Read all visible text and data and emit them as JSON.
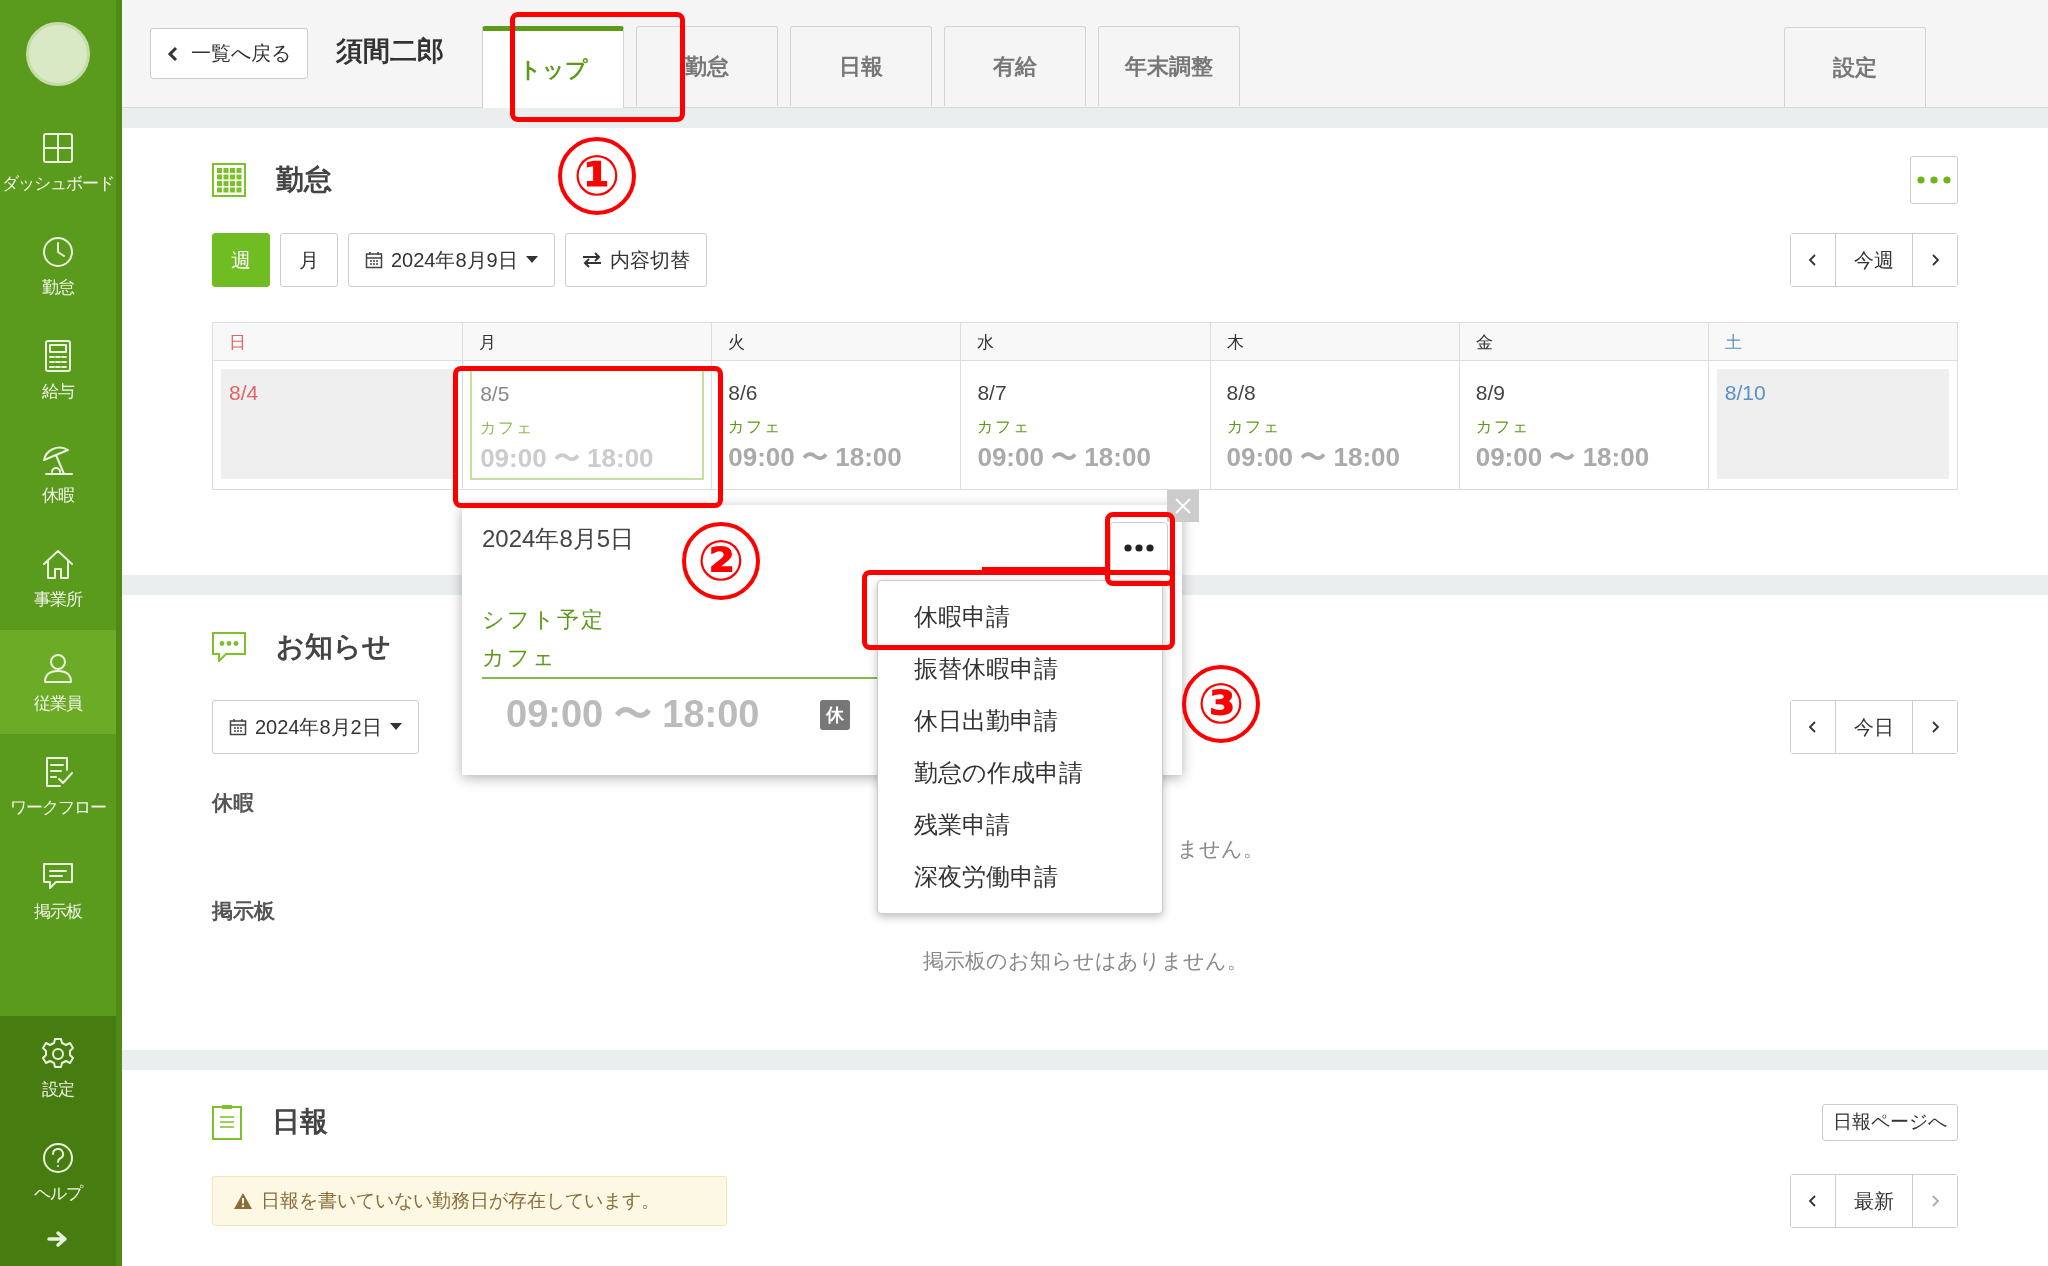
{
  "sidebar": {
    "items": [
      {
        "label": "ダッシュボード",
        "selected": false
      },
      {
        "label": "勤怠",
        "selected": false
      },
      {
        "label": "給与",
        "selected": false
      },
      {
        "label": "休暇",
        "selected": false
      },
      {
        "label": "事業所",
        "selected": false
      },
      {
        "label": "従業員",
        "selected": true
      },
      {
        "label": "ワークフロー",
        "selected": false
      },
      {
        "label": "掲示板",
        "selected": false
      }
    ],
    "bottom_items": [
      {
        "label": "設定"
      },
      {
        "label": "ヘルプ"
      }
    ]
  },
  "header": {
    "back_button": "一覧へ戻る",
    "employee_name": "須間二郎",
    "tabs": [
      {
        "label": "トップ",
        "selected": true
      },
      {
        "label": "勤怠",
        "selected": false
      },
      {
        "label": "日報",
        "selected": false
      },
      {
        "label": "有給",
        "selected": false
      },
      {
        "label": "年末調整",
        "selected": false
      }
    ],
    "settings_tab": "設定"
  },
  "attendance": {
    "title": "勤怠",
    "view_buttons": [
      {
        "label": "週",
        "selected": true
      },
      {
        "label": "月",
        "selected": false
      }
    ],
    "date_picker": "2024年8月9日",
    "toggle_button": "内容切替",
    "nav_label": "今週",
    "days": [
      {
        "weekday": "日",
        "date": "8/4",
        "kind": "sunday",
        "selected": false
      },
      {
        "weekday": "月",
        "date": "8/5",
        "kind": "weekday",
        "shift": "カフェ",
        "time": "09:00 〜 18:00",
        "selected": true
      },
      {
        "weekday": "火",
        "date": "8/6",
        "kind": "weekday",
        "shift": "カフェ",
        "time": "09:00 〜 18:00",
        "selected": false
      },
      {
        "weekday": "水",
        "date": "8/7",
        "kind": "weekday",
        "shift": "カフェ",
        "time": "09:00 〜 18:00",
        "selected": false
      },
      {
        "weekday": "木",
        "date": "8/8",
        "kind": "weekday",
        "shift": "カフェ",
        "time": "09:00 〜 18:00",
        "selected": false
      },
      {
        "weekday": "金",
        "date": "8/9",
        "kind": "weekday",
        "shift": "カフェ",
        "time": "09:00 〜 18:00",
        "selected": false
      },
      {
        "weekday": "土",
        "date": "8/10",
        "kind": "saturday",
        "selected": false
      }
    ]
  },
  "popup": {
    "date": "2024年8月5日",
    "label": "シフト予定",
    "shift": "カフェ",
    "time": "09:00 〜 18:00",
    "badge": "休"
  },
  "menu": {
    "items": [
      {
        "label": "休暇申請"
      },
      {
        "label": "振替休暇申請"
      },
      {
        "label": "休日出勤申請"
      },
      {
        "label": "勤怠の作成申請"
      },
      {
        "label": "残業申請"
      },
      {
        "label": "深夜労働申請"
      }
    ]
  },
  "notices": {
    "title": "お知らせ",
    "date_picker": "2024年8月2日",
    "nav_label": "今日",
    "groups": [
      {
        "label": "休暇",
        "message": "ません。"
      },
      {
        "label": "掲示板",
        "message": "掲示板のお知らせはありません。"
      }
    ]
  },
  "daily_report": {
    "title": "日報",
    "page_button": "日報ページへ",
    "warning": "日報を書いていない勤務日が存在しています。",
    "nav_label": "最新"
  },
  "annotations": [
    {
      "label": "①"
    },
    {
      "label": "②"
    },
    {
      "label": "③"
    }
  ]
}
